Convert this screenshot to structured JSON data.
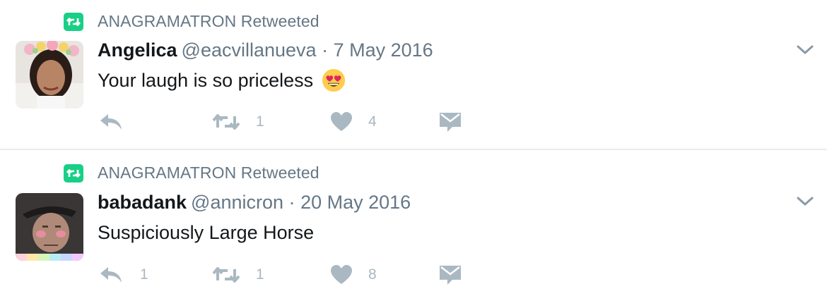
{
  "tweets": [
    {
      "context": "ANAGRAMATRON Retweeted",
      "name": "Angelica",
      "handle": "@eacvillanueva",
      "separator": "·",
      "date": "7 May 2016",
      "text": "Your laugh is so priceless",
      "emoji": "heart-eyes-emoji",
      "reply_count": "",
      "retweet_count": "1",
      "like_count": "4"
    },
    {
      "context": "ANAGRAMATRON Retweeted",
      "name": "babadank",
      "handle": "@annicron",
      "separator": "·",
      "date": "20 May 2016",
      "text": "Suspiciously Large Horse",
      "reply_count": "1",
      "retweet_count": "1",
      "like_count": "8"
    }
  ],
  "colors": {
    "retweet_badge": "#19cf86",
    "secondary_text": "#657786",
    "action_icon": "#aab8c2",
    "divider": "#e6ecf0"
  }
}
